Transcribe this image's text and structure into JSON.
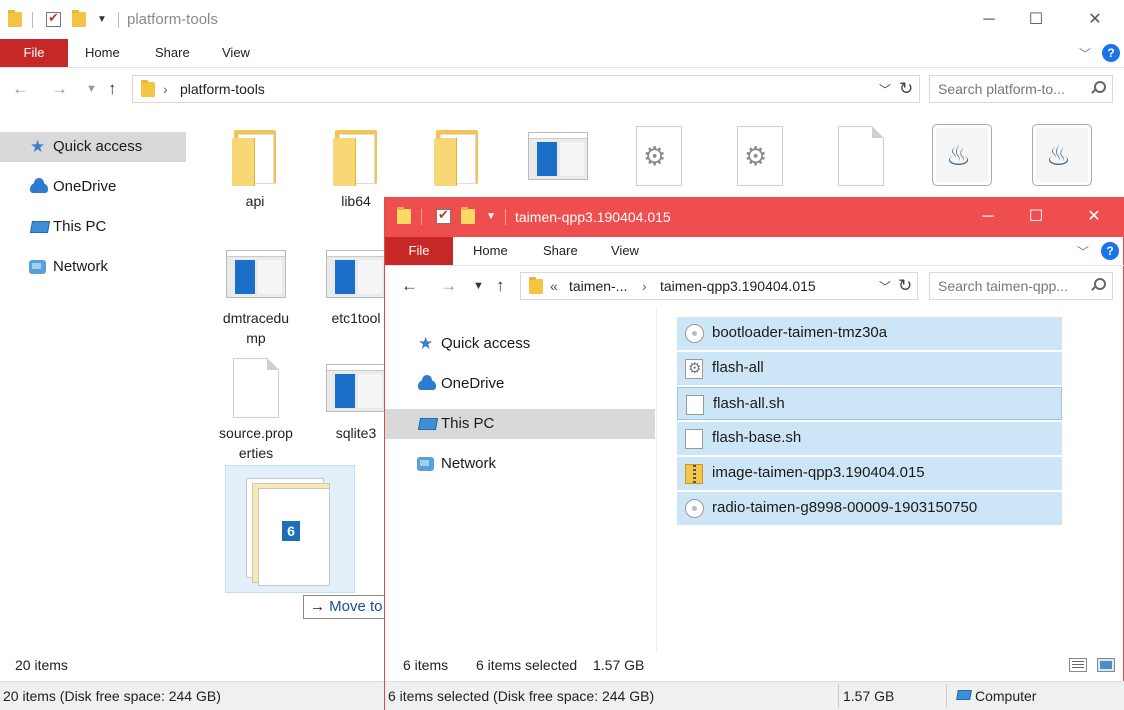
{
  "colors": {
    "file_tab": "#c62828",
    "active_title": "#ef4e4e",
    "selection": "#cde6f7",
    "help": "#1a73e8"
  },
  "background_window": {
    "title": "platform-tools",
    "ribbon": {
      "file": "File",
      "tabs": [
        "Home",
        "Share",
        "View"
      ]
    },
    "address": {
      "path": "platform-tools"
    },
    "search_placeholder": "Search platform-to...",
    "sidebar": [
      {
        "label": "Quick access",
        "icon": "star-icon"
      },
      {
        "label": "OneDrive",
        "icon": "cloud-icon"
      },
      {
        "label": "This PC",
        "icon": "computer-icon"
      },
      {
        "label": "Network",
        "icon": "network-icon"
      }
    ],
    "files": [
      {
        "name": "api",
        "icon": "folder-icon"
      },
      {
        "name": "lib64",
        "icon": "folder-icon"
      },
      {
        "name": "",
        "icon": "folder-icon"
      },
      {
        "name": "",
        "icon": "app-icon"
      },
      {
        "name": "",
        "icon": "settings-file-icon"
      },
      {
        "name": "",
        "icon": "settings-file-icon"
      },
      {
        "name": "",
        "icon": "document-icon"
      },
      {
        "name": "",
        "icon": "java-icon"
      },
      {
        "name": "",
        "icon": "java-icon"
      },
      {
        "name": "dmtracedump",
        "name_line2": "mp",
        "display": "dmtracedu",
        "icon": "app-icon"
      },
      {
        "name": "etc1tool",
        "icon": "app-icon"
      },
      {
        "name": "source.properties",
        "display": "source.prop",
        "name_line2": "erties",
        "icon": "document-icon"
      },
      {
        "name": "sqlite3",
        "icon": "app-icon"
      }
    ],
    "drag": {
      "count": "6",
      "tooltip": "Move to platform-tools"
    },
    "status_items": "20 items",
    "bottom_status": "20 items (Disk free space: 244 GB)"
  },
  "foreground_window": {
    "title": "taimen-qpp3.190404.015",
    "ribbon": {
      "file": "File",
      "tabs": [
        "Home",
        "Share",
        "View"
      ]
    },
    "address": {
      "prefix": "«",
      "crumbs": [
        "taimen-...",
        "taimen-qpp3.190404.015"
      ]
    },
    "search_placeholder": "Search taimen-qpp...",
    "sidebar": [
      {
        "label": "Quick access",
        "icon": "star-icon"
      },
      {
        "label": "OneDrive",
        "icon": "cloud-icon"
      },
      {
        "label": "This PC",
        "icon": "computer-icon",
        "selected": true
      },
      {
        "label": "Network",
        "icon": "network-icon"
      }
    ],
    "files": [
      {
        "name": "bootloader-taimen-tmz30a",
        "icon": "disc-image-icon"
      },
      {
        "name": "flash-all",
        "icon": "batch-file-icon"
      },
      {
        "name": "flash-all.sh",
        "icon": "document-icon"
      },
      {
        "name": "flash-base.sh",
        "icon": "document-icon"
      },
      {
        "name": "image-taimen-qpp3.190404.015",
        "icon": "zip-icon"
      },
      {
        "name": "radio-taimen-g8998-00009-1903150750",
        "icon": "disc-image-icon"
      }
    ],
    "status": {
      "count": "6 items",
      "selected": "6 items selected",
      "size": "1.57 GB"
    },
    "bottom_status": {
      "selected": "6 items selected (Disk free space: 244 GB)",
      "size": "1.57 GB",
      "location": "Computer"
    }
  }
}
